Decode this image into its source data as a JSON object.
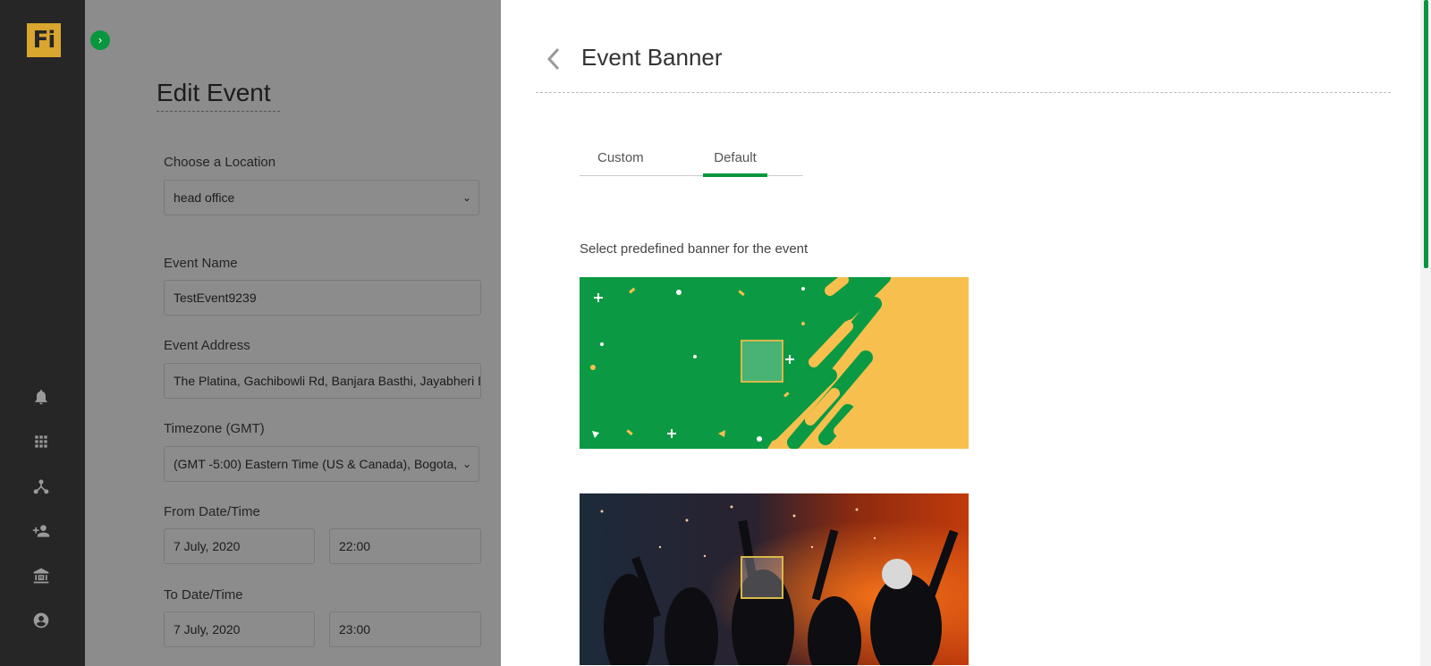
{
  "app": {
    "logo_text": "Fi",
    "accent_color": "#08963e",
    "logo_color": "#d9a62e"
  },
  "sidebar": {
    "items": [
      {
        "icon": "bell-icon"
      },
      {
        "icon": "grid-icon"
      },
      {
        "icon": "hierarchy-icon"
      },
      {
        "icon": "add-user-icon"
      },
      {
        "icon": "bank-icon"
      },
      {
        "icon": "account-icon"
      }
    ]
  },
  "form": {
    "title": "Edit Event",
    "location_label": "Choose a Location",
    "location_value": "head office",
    "event_name_label": "Event Name",
    "event_name_value": "TestEvent9239",
    "event_address_label": "Event Address",
    "event_address_value": "The Platina, Gachibowli Rd, Banjara Basthi, Jayabheri E",
    "timezone_label": "Timezone (GMT)",
    "timezone_value": "(GMT -5:00) Eastern Time (US & Canada), Bogota,",
    "from_label": "From Date/Time",
    "from_date": "7 July, 2020",
    "from_time": "22:00",
    "to_label": "To Date/Time",
    "to_date": "7 July, 2020",
    "to_time": "23:00"
  },
  "panel": {
    "title": "Event Banner",
    "tabs": [
      {
        "label": "Custom",
        "active": false
      },
      {
        "label": "Default",
        "active": true
      }
    ],
    "hint": "Select predefined banner for the event",
    "banners": [
      {
        "name": "green-yellow-confetti-banner"
      },
      {
        "name": "party-crowd-banner"
      }
    ]
  }
}
